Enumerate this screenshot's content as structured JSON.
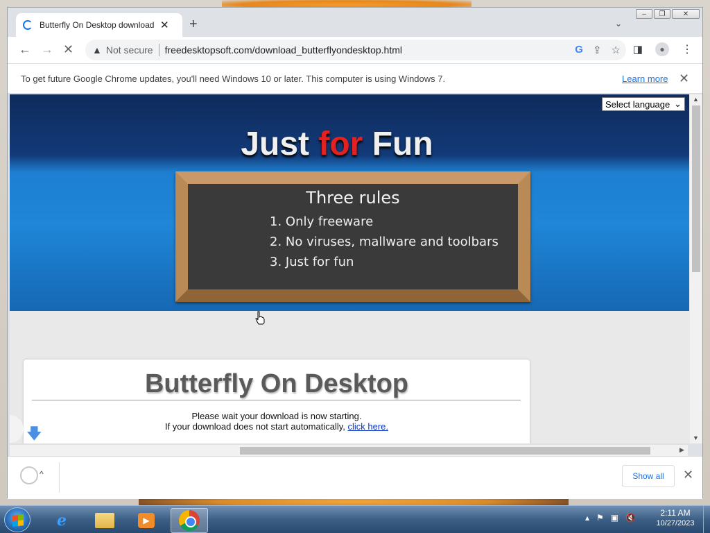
{
  "browser": {
    "tab_title": "Butterfly On Desktop download p",
    "new_tab_icon": "+",
    "address": {
      "security_label": "Not secure",
      "url": "freedesktopsoft.com/download_butterflyondesktop.html"
    },
    "infobar": {
      "message": "To get future Google Chrome updates, you'll need Windows 10 or later. This computer is using Windows 7.",
      "link": "Learn more"
    },
    "download_shelf": {
      "show_all": "Show all"
    }
  },
  "page": {
    "select_language": "Select language",
    "banner": {
      "title_part1": "Just ",
      "title_part2": "for",
      "title_part3": " Fun",
      "board_title": "Three rules",
      "rules": [
        "1. Only freeware",
        "2. No viruses, mallware and toolbars",
        "3. Just for fun"
      ]
    },
    "card": {
      "title": "Butterfly On Desktop",
      "wait_text": "Please wait your download is now starting.",
      "fallback_text": "If your download does not start automatically, ",
      "fallback_link": "click here."
    }
  },
  "taskbar": {
    "time": "2:11 AM",
    "date": "10/27/2023"
  },
  "colors": {
    "accent_red": "#e32121",
    "link_blue": "#1a73e8",
    "banner_blue": "#1f86d8"
  }
}
